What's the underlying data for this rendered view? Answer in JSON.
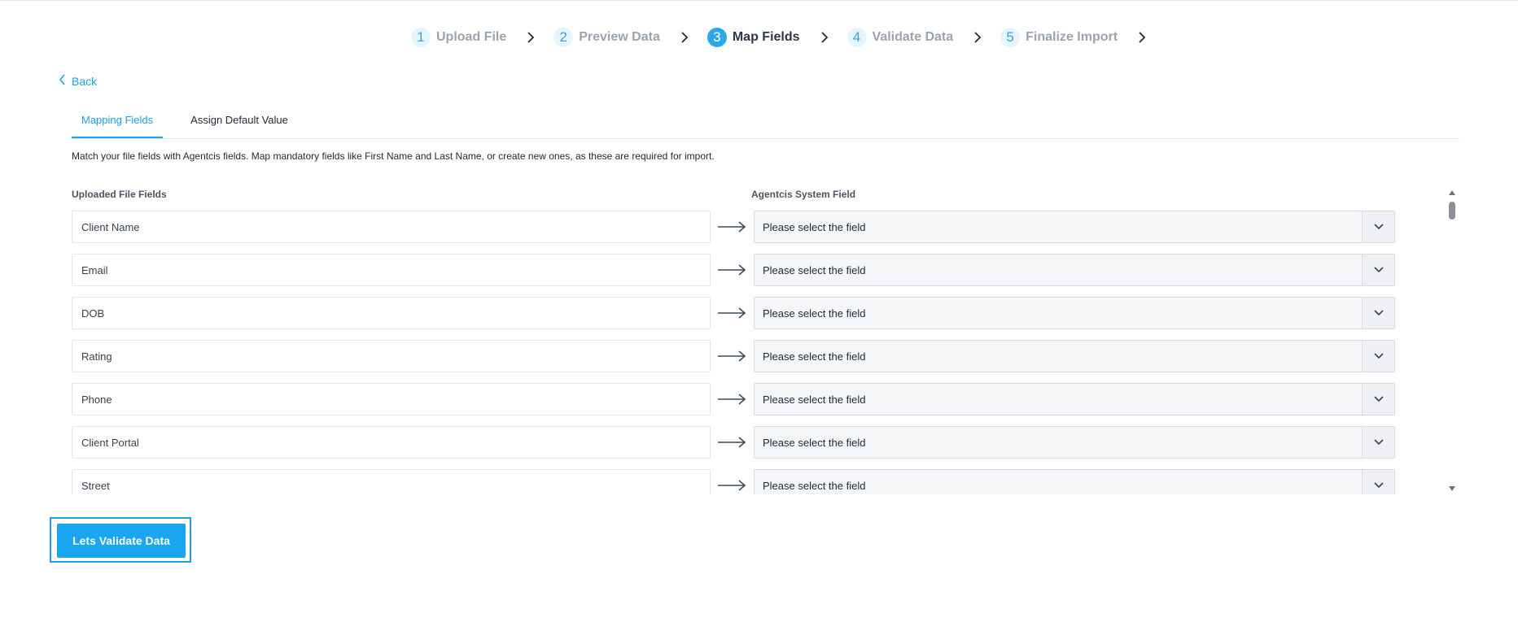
{
  "stepper": {
    "steps": [
      {
        "num": "1",
        "label": "Upload File"
      },
      {
        "num": "2",
        "label": "Preview Data"
      },
      {
        "num": "3",
        "label": "Map Fields"
      },
      {
        "num": "4",
        "label": "Validate Data"
      },
      {
        "num": "5",
        "label": "Finalize Import"
      }
    ],
    "active_index": 2
  },
  "back_label": "Back",
  "tabs": [
    {
      "label": "Mapping Fields",
      "active": true
    },
    {
      "label": "Assign Default Value",
      "active": false
    }
  ],
  "instruction": "Match your file fields with Agentcis fields. Map mandatory fields like First Name and Last Name, or create new ones, as these are required for import.",
  "columns": {
    "uploaded": "Uploaded File Fields",
    "system": "Agentcis System Field"
  },
  "rows": [
    {
      "field": "Client Name",
      "selected": "Please select the field"
    },
    {
      "field": "Email",
      "selected": "Please select the field"
    },
    {
      "field": "DOB",
      "selected": "Please select the field"
    },
    {
      "field": "Rating",
      "selected": "Please select the field"
    },
    {
      "field": "Phone",
      "selected": "Please select the field"
    },
    {
      "field": "Client Portal",
      "selected": "Please select the field"
    },
    {
      "field": "Street",
      "selected": "Please select the field"
    }
  ],
  "primary_button": "Lets Validate Data",
  "colors": {
    "accent": "#19a5ef",
    "active_step": "#2ea7e8",
    "inactive_text": "#9aa3ae"
  }
}
